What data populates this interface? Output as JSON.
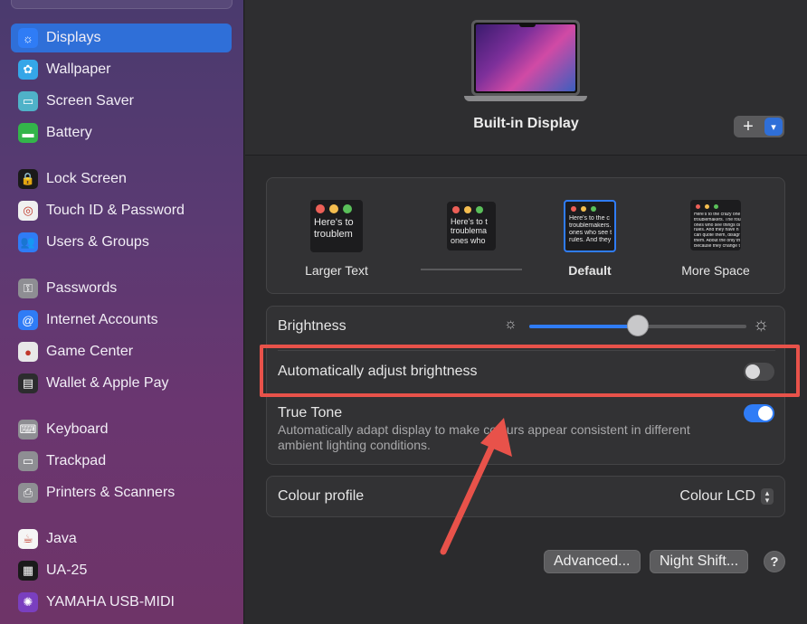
{
  "sidebar": {
    "items": [
      {
        "label": "Displays",
        "icon": "displays-icon",
        "color": "#2f7cf6",
        "glyph": "☼",
        "selected": true
      },
      {
        "label": "Wallpaper",
        "icon": "wallpaper-icon",
        "color": "#35a6e8",
        "glyph": "✿"
      },
      {
        "label": "Screen Saver",
        "icon": "screen-saver-icon",
        "color": "#4fb2c8",
        "glyph": "▭"
      },
      {
        "label": "Battery",
        "icon": "battery-icon",
        "color": "#33b54a",
        "glyph": "▬"
      },
      {
        "label": "Lock Screen",
        "icon": "lock-screen-icon",
        "color": "#1a1a1a",
        "glyph": "🔒"
      },
      {
        "label": "Touch ID & Password",
        "icon": "touch-id-icon",
        "color": "#f0f0f0",
        "glyph": "◎"
      },
      {
        "label": "Users & Groups",
        "icon": "users-groups-icon",
        "color": "#2f7cf6",
        "glyph": "👥"
      },
      {
        "label": "Passwords",
        "icon": "passwords-icon",
        "color": "#8e8e93",
        "glyph": "⚿"
      },
      {
        "label": "Internet Accounts",
        "icon": "internet-accounts-icon",
        "color": "#2f7cf6",
        "glyph": "@"
      },
      {
        "label": "Game Center",
        "icon": "game-center-icon",
        "color": "#e8e8e8",
        "glyph": "●"
      },
      {
        "label": "Wallet & Apple Pay",
        "icon": "wallet-icon",
        "color": "#2c2c2e",
        "glyph": "▤"
      },
      {
        "label": "Keyboard",
        "icon": "keyboard-icon",
        "color": "#8e8e93",
        "glyph": "⌨"
      },
      {
        "label": "Trackpad",
        "icon": "trackpad-icon",
        "color": "#8e8e93",
        "glyph": "▭"
      },
      {
        "label": "Printers & Scanners",
        "icon": "printers-icon",
        "color": "#8e8e93",
        "glyph": "⎙"
      },
      {
        "label": "Java",
        "icon": "java-icon",
        "color": "#f5f5f5",
        "glyph": "☕"
      },
      {
        "label": "UA-25",
        "icon": "ua25-icon",
        "color": "#1a1a1a",
        "glyph": "▦"
      },
      {
        "label": "YAMAHA USB-MIDI",
        "icon": "yamaha-icon",
        "color": "#7a3fbf",
        "glyph": "✺"
      }
    ]
  },
  "header": {
    "display_name": "Built-in Display",
    "add_label": "+",
    "dropdown_icon": "chevron-down-icon"
  },
  "resolution": {
    "options": [
      {
        "label": "Larger Text",
        "preview": [
          "Here's to",
          "troublem"
        ]
      },
      {
        "label": "",
        "preview": [
          "Here's to t",
          "troublema",
          "ones who"
        ]
      },
      {
        "label": "Default",
        "preview": [
          "Here's to the c",
          "troublemakers.",
          "ones who see t",
          "rules. And they"
        ]
      },
      {
        "label": "More Space",
        "preview": [
          "Here's to the crazy one",
          "troublemakers. The rou",
          "ones who see things di",
          "rules. And they have n",
          "can quote them, disagr",
          "them. About the only th",
          "Because they change t"
        ]
      }
    ],
    "selected": "Default"
  },
  "brightness": {
    "label": "Brightness",
    "level": 0.5
  },
  "auto_brightness": {
    "label": "Automatically adjust brightness",
    "on": false
  },
  "true_tone": {
    "label": "True Tone",
    "description": "Automatically adapt display to make colours appear consistent in different ambient lighting conditions.",
    "on": true
  },
  "colour_profile": {
    "label": "Colour profile",
    "value": "Colour LCD"
  },
  "buttons": {
    "advanced": "Advanced...",
    "night_shift": "Night Shift...",
    "help": "?"
  },
  "colors": {
    "accent": "#2f7cf6",
    "highlight": "#e8524a"
  }
}
